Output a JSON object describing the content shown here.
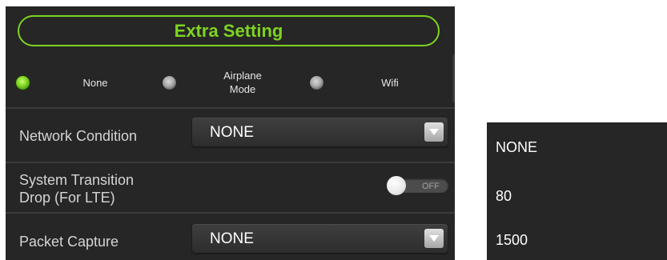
{
  "header": {
    "title": "Extra Setting"
  },
  "mode_options": [
    {
      "label": "None",
      "selected": true
    },
    {
      "label": "Airplane Mode",
      "label_lines": [
        "Airplane",
        "Mode"
      ],
      "selected": false
    },
    {
      "label": "Wifi",
      "selected": false
    }
  ],
  "settings": {
    "network_condition": {
      "label": "Network Condition",
      "value": "NONE"
    },
    "system_transition_drop": {
      "label": "System Transition Drop (For LTE)",
      "label_lines": [
        "System Transition",
        "Drop (For LTE)"
      ],
      "toggle_text": "OFF",
      "enabled": false
    },
    "packet_capture": {
      "label": "Packet Capture",
      "value": "NONE"
    }
  },
  "dropdown_options": [
    "NONE",
    "80",
    "1500"
  ],
  "colors": {
    "accent": "#7ed321",
    "panel_bg": "#262626",
    "label_text": "#d4d4d4"
  },
  "icons": {
    "dropdown_arrow": "caret-down-icon"
  }
}
